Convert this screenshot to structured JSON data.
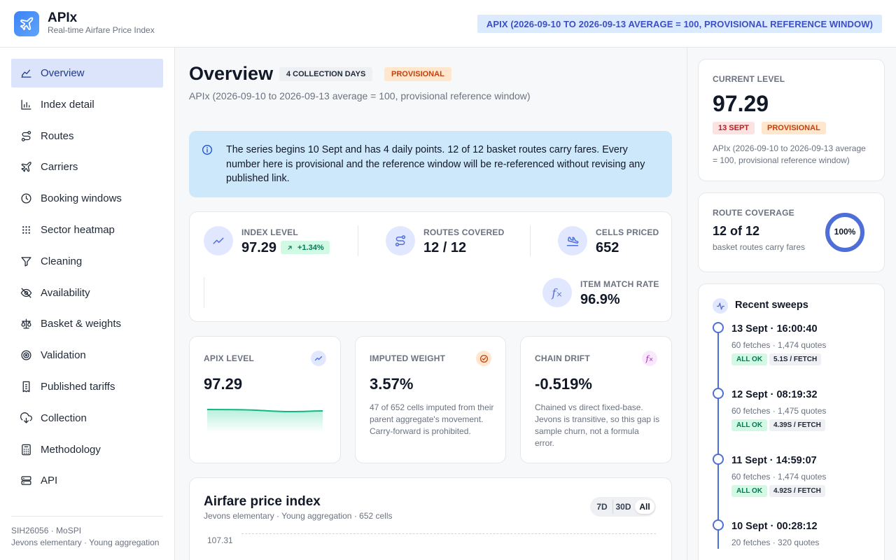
{
  "header": {
    "app_name": "APIx",
    "app_subtitle": "Real-time Airfare Price Index",
    "reference_banner": "APIX (2026-09-10 TO 2026-09-13 AVERAGE = 100, PROVISIONAL REFERENCE WINDOW)"
  },
  "sidebar": {
    "items": [
      {
        "label": "Overview",
        "icon": "overview-icon"
      },
      {
        "label": "Index detail",
        "icon": "bar-chart-icon"
      },
      {
        "label": "Routes",
        "icon": "route-icon"
      },
      {
        "label": "Carriers",
        "icon": "plane-icon"
      },
      {
        "label": "Booking windows",
        "icon": "clock-icon"
      },
      {
        "label": "Sector heatmap",
        "icon": "grid-icon"
      },
      {
        "label": "Cleaning",
        "icon": "filter-icon"
      },
      {
        "label": "Availability",
        "icon": "eye-off-icon"
      },
      {
        "label": "Basket & weights",
        "icon": "scale-icon"
      },
      {
        "label": "Validation",
        "icon": "target-icon"
      },
      {
        "label": "Published tariffs",
        "icon": "receipt-icon"
      },
      {
        "label": "Collection",
        "icon": "cloud-download-icon"
      },
      {
        "label": "Methodology",
        "icon": "calculator-icon"
      },
      {
        "label": "API",
        "icon": "server-icon"
      }
    ],
    "active_index": 0,
    "footer_line1": "SIH26056 · MoSPI",
    "footer_line2": "Jevons elementary · Young aggregation"
  },
  "main": {
    "title": "Overview",
    "badge_days": "4 COLLECTION DAYS",
    "badge_status": "PROVISIONAL",
    "subtitle": "APIx (2026-09-10 to 2026-09-13 average = 100, provisional reference window)",
    "info_text": "The series begins 10 Sept and has 4 daily points. 12 of 12 basket routes carry fares. Every number here is provisional and the reference window will be re-referenced without revising any published link.",
    "stats": {
      "index_level_label": "INDEX LEVEL",
      "index_level_value": "97.29",
      "index_delta": "+1.34%",
      "routes_label": "ROUTES COVERED",
      "routes_value": "12 / 12",
      "cells_label": "CELLS PRICED",
      "cells_value": "652",
      "match_label": "ITEM MATCH RATE",
      "match_value": "96.9%"
    },
    "mini_cards": {
      "apix_label": "APIX LEVEL",
      "apix_value": "97.29",
      "imputed_label": "IMPUTED WEIGHT",
      "imputed_value": "3.57%",
      "imputed_desc": "47 of 652 cells imputed from their parent aggregate's movement. Carry-forward is prohibited.",
      "drift_label": "CHAIN DRIFT",
      "drift_value": "-0.519%",
      "drift_desc": "Chained vs direct fixed-base. Jevons is transitive, so this gap is sample churn, not a formula error."
    },
    "chart": {
      "title": "Airfare price index",
      "subtitle": "Jevons elementary · Young aggregation · 652 cells",
      "ranges": [
        "7D",
        "30D",
        "All"
      ],
      "active_range": "All",
      "y_tick_top": "107.31"
    }
  },
  "right": {
    "current_label": "CURRENT LEVEL",
    "current_value": "97.29",
    "current_date": "13 SEPT",
    "current_status": "PROVISIONAL",
    "current_note": "APIx (2026-09-10 to 2026-09-13 average = 100, provisional reference window)",
    "coverage_label": "ROUTE COVERAGE",
    "coverage_value": "12 of 12",
    "coverage_note": "basket routes carry fares",
    "coverage_percent": "100%",
    "coverage_fraction": 1.0,
    "sweeps_title": "Recent sweeps",
    "sweeps": [
      {
        "time": "13 Sept · 16:00:40",
        "meta": "60 fetches · 1,474 quotes",
        "status": "ALL OK",
        "rate": "5.1S / FETCH"
      },
      {
        "time": "12 Sept · 08:19:32",
        "meta": "60 fetches · 1,475 quotes",
        "status": "ALL OK",
        "rate": "4.39S / FETCH"
      },
      {
        "time": "11 Sept · 14:59:07",
        "meta": "60 fetches · 1,474 quotes",
        "status": "ALL OK",
        "rate": "4.92S / FETCH"
      },
      {
        "time": "10 Sept · 00:28:12",
        "meta": "20 fetches · 320 quotes"
      }
    ]
  },
  "colors": {
    "accent": "#4f6fd8",
    "active_nav_bg": "#dbe4fb",
    "info_bg": "#cde7fb",
    "ok_green": "#047857",
    "provisional_orange": "#c2410c"
  }
}
